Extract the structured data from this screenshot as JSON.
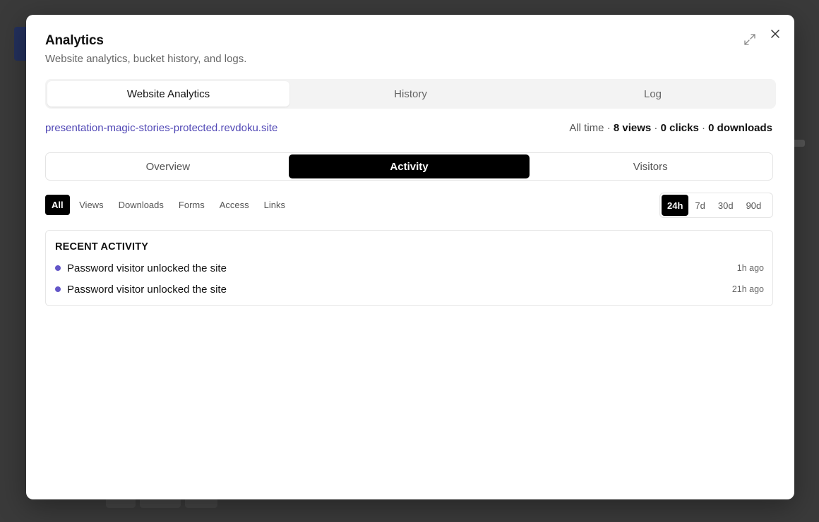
{
  "modal": {
    "title": "Analytics",
    "subtitle": "Website analytics, bucket history, and logs."
  },
  "main_tabs": [
    {
      "label": "Website Analytics",
      "active": true
    },
    {
      "label": "History",
      "active": false
    },
    {
      "label": "Log",
      "active": false
    }
  ],
  "site": {
    "url": "presentation-magic-stories-protected.revdoku.site",
    "period_label": "All time",
    "views": "8 views",
    "clicks": "0 clicks",
    "downloads": "0 downloads"
  },
  "sub_tabs": [
    {
      "label": "Overview",
      "active": false
    },
    {
      "label": "Activity",
      "active": true
    },
    {
      "label": "Visitors",
      "active": false
    }
  ],
  "filters": [
    {
      "label": "All",
      "active": true
    },
    {
      "label": "Views",
      "active": false
    },
    {
      "label": "Downloads",
      "active": false
    },
    {
      "label": "Forms",
      "active": false
    },
    {
      "label": "Access",
      "active": false
    },
    {
      "label": "Links",
      "active": false
    }
  ],
  "time_ranges": [
    {
      "label": "24h",
      "active": true
    },
    {
      "label": "7d",
      "active": false
    },
    {
      "label": "30d",
      "active": false
    },
    {
      "label": "90d",
      "active": false
    }
  ],
  "recent_activity": {
    "heading": "RECENT ACTIVITY",
    "items": [
      {
        "text": "Password visitor unlocked the site",
        "time": "1h ago"
      },
      {
        "text": "Password visitor unlocked the site",
        "time": "21h ago"
      }
    ]
  },
  "colors": {
    "accent_link": "#4f46b5",
    "activity_dot": "#6356c8",
    "active_tab_bg": "#000000",
    "overlay": "#3a3a3a"
  },
  "icons": {
    "expand": "expand-icon",
    "close": "close-icon"
  }
}
